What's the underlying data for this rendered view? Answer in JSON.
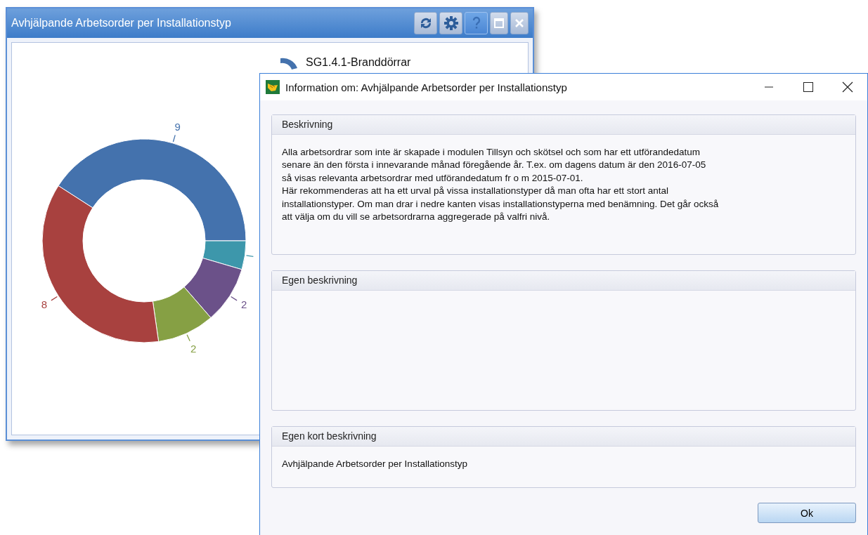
{
  "widget": {
    "title": "Avhjälpande Arbetsorder per Installationstyp",
    "toolbar": [
      {
        "kind": "refresh",
        "selected": false
      },
      {
        "kind": "settings",
        "selected": false
      },
      {
        "kind": "help",
        "selected": true
      },
      {
        "kind": "maximize",
        "selected": false
      },
      {
        "kind": "close",
        "selected": false
      }
    ],
    "legend": [
      {
        "label": "SG1.4.1-Branddörrar",
        "color": "#4472ad"
      }
    ],
    "chart_data": {
      "type": "donut",
      "values": [
        9,
        1,
        2,
        2,
        8
      ],
      "colors": [
        "#4472ad",
        "#3d97ab",
        "#6b5189",
        "#86a044",
        "#a8413f"
      ],
      "value_labels": [
        "9",
        null,
        "2",
        "2",
        "8"
      ]
    }
  },
  "dialog": {
    "title": "Information om: Avhjälpande Arbetsorder per Installationstyp",
    "sections": [
      {
        "title": "Beskrivning",
        "text": "Alla arbetsordrar som inte är skapade i modulen Tillsyn och skötsel och som har ett utförandedatum\nsenare än den första i innevarande månad föregående år. T.ex. om dagens datum är den 2016-07-05\nså visas relevanta arbetsordrar med utförandedatum fr o m 2015-07-01.\nHär rekommenderas att ha ett urval på vissa installationstyper då man ofta har ett stort antal\ninstallationstyper. Om man drar i nedre kanten visas installationstyperna med benämning. Det går också\natt välja om du vill se arbetsordrarna aggregerade på valfri nivå."
      },
      {
        "title": "Egen beskrivning"
      },
      {
        "title": "Egen kort beskrivning",
        "text": "Avhjälpande Arbetsorder per Installationstyp"
      }
    ],
    "ok_button": "Ok"
  }
}
